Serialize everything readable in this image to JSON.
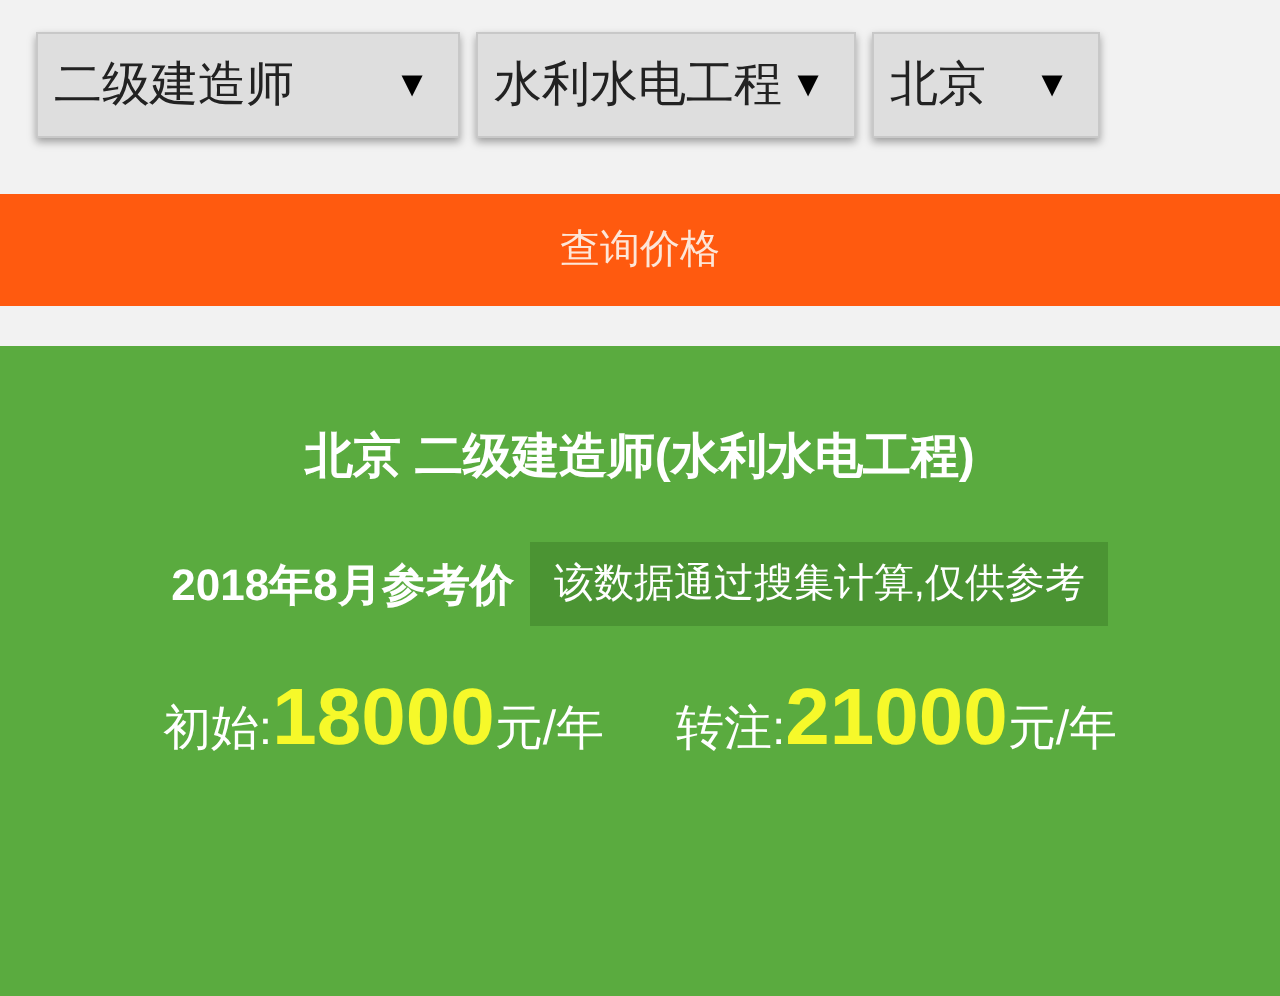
{
  "dropdowns": [
    {
      "value": "二级建造师",
      "arrow": "▼"
    },
    {
      "value": "水利水电工程",
      "arrow": "▼"
    },
    {
      "value": "北京",
      "arrow": "▼"
    }
  ],
  "query_button": "查询价格",
  "result": {
    "title": "北京 二级建造师(水利水电工程)",
    "period": "2018年8月参考价",
    "note": "该数据通过搜集计算,仅供参考",
    "prices": [
      {
        "label": "初始:",
        "value": "18000",
        "unit": "元/年"
      },
      {
        "label": "转注:",
        "value": "21000",
        "unit": "元/年"
      }
    ]
  }
}
